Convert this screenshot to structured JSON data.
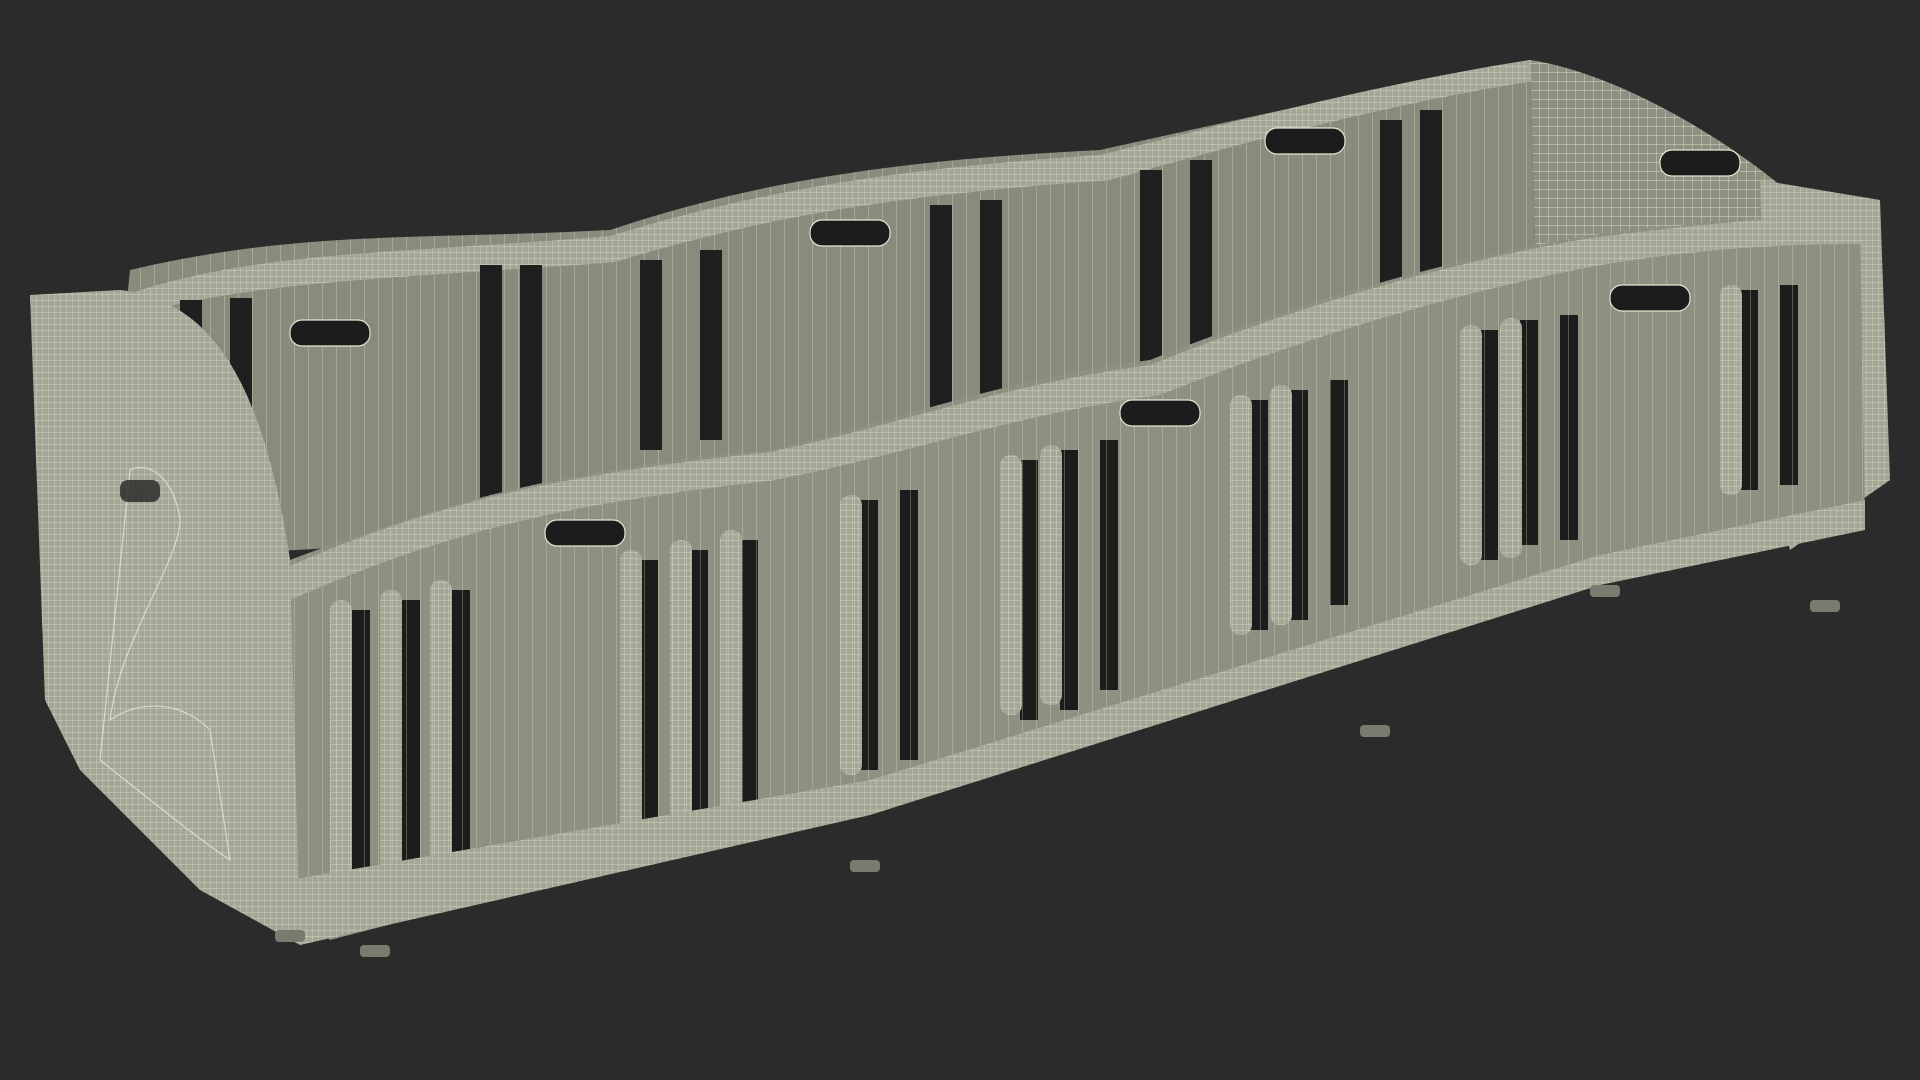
{
  "scene": {
    "subject": "wireframe-playpen-render",
    "colors": {
      "background": "#2b2b2b",
      "panel_fill": "#8f8f82",
      "panel_fill_dark": "#7a7a6e",
      "frame_fill": "#a6a697",
      "wire": "#e6e6d3",
      "shadow": "#1e1e1e"
    }
  }
}
